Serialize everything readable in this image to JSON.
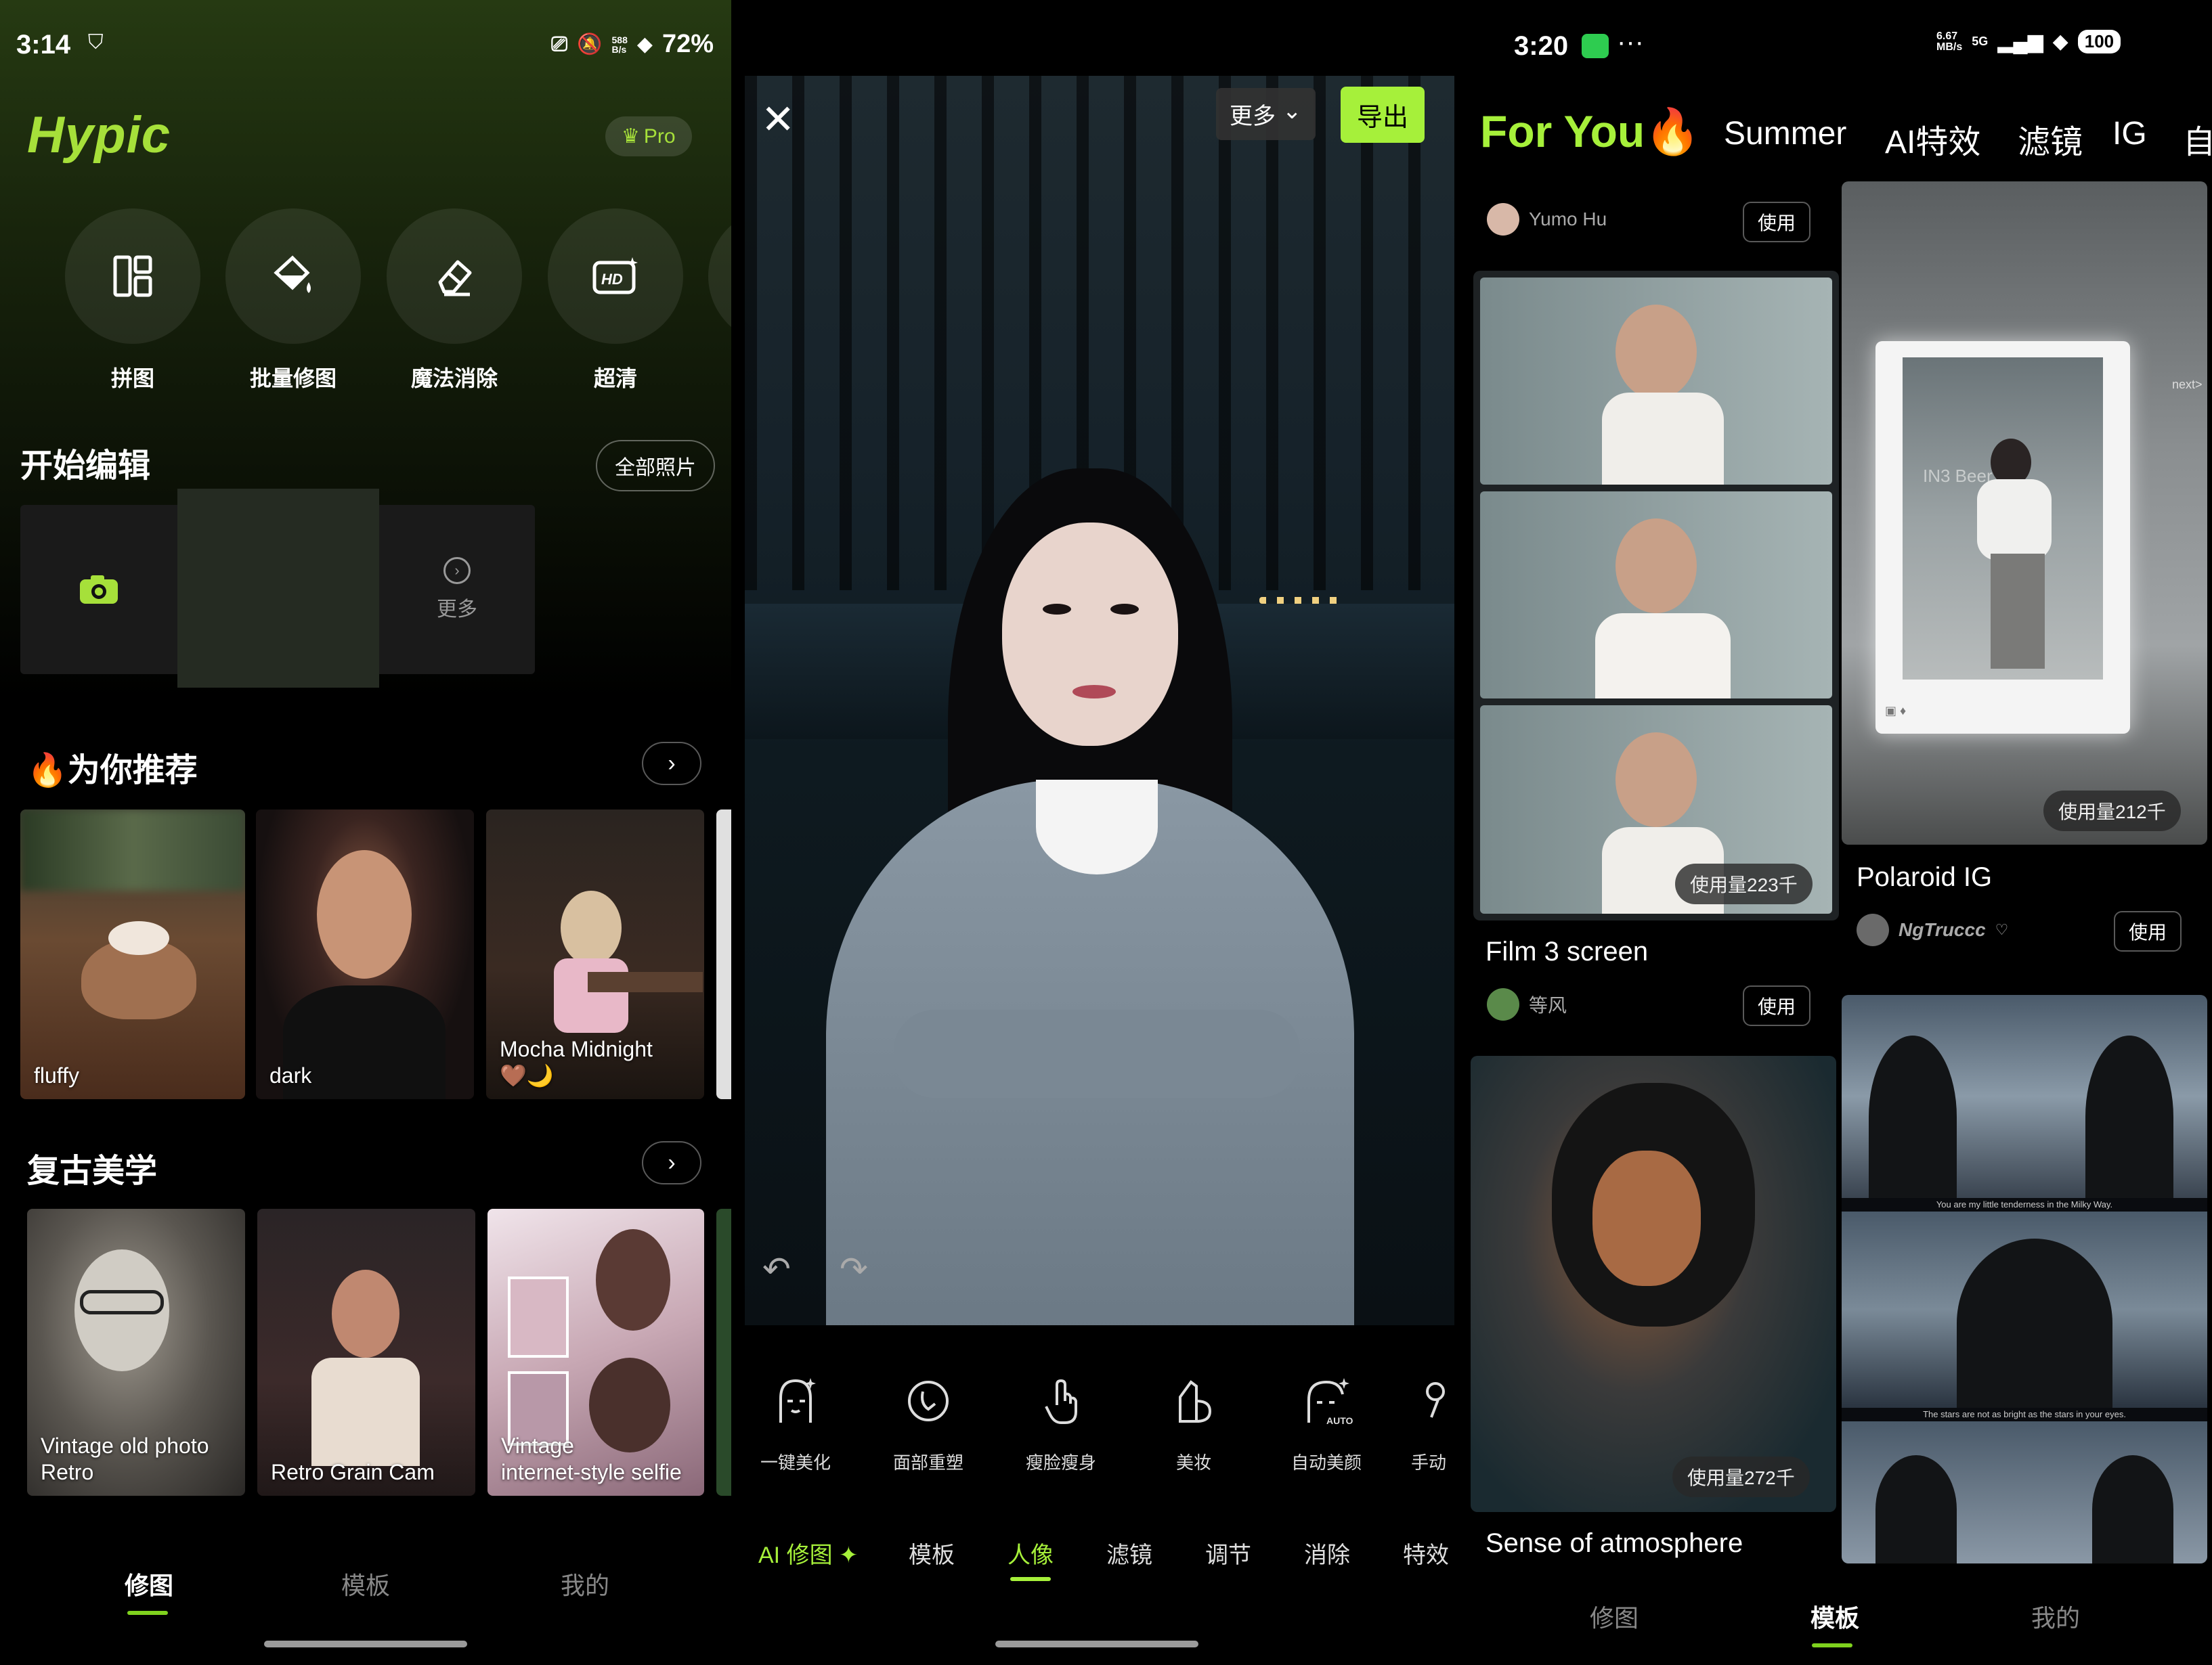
{
  "panel1": {
    "status": {
      "time": "3:14",
      "speed": "588\nB/s",
      "battery": "72%"
    },
    "logo": "Hypic",
    "pro_label": "Pro",
    "tools": [
      {
        "label": "拼图",
        "icon": "collage-icon"
      },
      {
        "label": "批量修图",
        "icon": "batch-edit-icon"
      },
      {
        "label": "魔法消除",
        "icon": "eraser-icon"
      },
      {
        "label": "超清",
        "icon": "hd-icon"
      }
    ],
    "start_edit": {
      "title": "开始编辑",
      "all_photos": "全部照片",
      "more": "更多"
    },
    "recommend": {
      "title": "🔥为你推荐",
      "cards": [
        {
          "label": "fluffy"
        },
        {
          "label": "dark"
        },
        {
          "label": "Mocha Midnight\n🤎🌙"
        }
      ]
    },
    "retro": {
      "title": "复古美学",
      "cards": [
        {
          "label": "Vintage old photo\nRetro"
        },
        {
          "label": "Retro Grain Cam"
        },
        {
          "label": "Vintage\ninternet-style selfie"
        }
      ]
    },
    "nav": {
      "edit": "修图",
      "templates": "模板",
      "me": "我的"
    }
  },
  "panel2": {
    "more": "更多",
    "export": "导出",
    "tools": [
      {
        "label": "一键美化",
        "icon": "auto-beautify-icon"
      },
      {
        "label": "面部重塑",
        "icon": "face-reshape-icon"
      },
      {
        "label": "瘦脸瘦身",
        "icon": "slim-icon"
      },
      {
        "label": "美妆",
        "icon": "makeup-icon"
      },
      {
        "label": "自动美颜",
        "icon": "auto-beauty-icon"
      },
      {
        "label": "手动",
        "icon": "manual-icon"
      }
    ],
    "tabs": [
      {
        "label": "AI 修图 ✦"
      },
      {
        "label": "模板"
      },
      {
        "label": "人像"
      },
      {
        "label": "滤镜"
      },
      {
        "label": "调节"
      },
      {
        "label": "消除"
      },
      {
        "label": "特效"
      }
    ],
    "active_tab_index": 2,
    "accent": "#a6f03a"
  },
  "panel3": {
    "status": {
      "time": "3:20",
      "speed": "6.67\nMB/s",
      "network": "5G",
      "battery": "100"
    },
    "tabs": [
      {
        "label": "For You🔥"
      },
      {
        "label": "Summer"
      },
      {
        "label": "AI特效"
      },
      {
        "label": "滤镜"
      },
      {
        "label": "IG"
      },
      {
        "label": "自"
      }
    ],
    "top_author": "Yumo Hu",
    "use_label": "使用",
    "templates": [
      {
        "title": "Film 3 screen",
        "usage": "使用量223千",
        "author": "等风"
      },
      {
        "title": "Polaroid IG",
        "usage": "使用量212千",
        "author": "NgTruccc"
      },
      {
        "title": "Sense of atmosphere",
        "usage": "使用量272千"
      }
    ],
    "captions": [
      "You are my little tenderness in the Milky Way.",
      "The stars are not as bright as the stars in your eyes."
    ],
    "polaroid_side_text": "next>",
    "polaroid_wall_text": "IN3 Beer",
    "nav": {
      "edit": "修图",
      "templates": "模板",
      "me": "我的"
    }
  }
}
